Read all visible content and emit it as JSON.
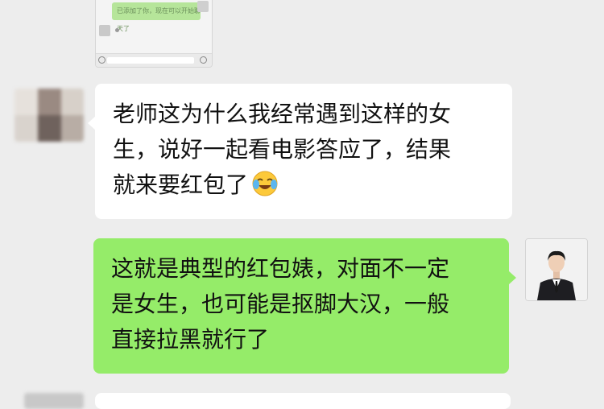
{
  "quoted_screenshot": {
    "bubble_text": "已添加了你，现在可以开始聊天了"
  },
  "incoming_message": {
    "lines": [
      "老师这为什么我经常遇到这样的女",
      "生，说好一起看电影答应了，结果",
      "就来要红包了"
    ],
    "emoji": "crying-laughing-emoji"
  },
  "outgoing_message": {
    "lines": [
      "这就是典型的红包婊，对面不一定",
      "是女生，也可能是抠脚大汉，一般",
      "直接拉黑就行了"
    ]
  },
  "colors": {
    "background": "#ededed",
    "incoming_bubble": "#ffffff",
    "outgoing_bubble": "#95ec69"
  }
}
